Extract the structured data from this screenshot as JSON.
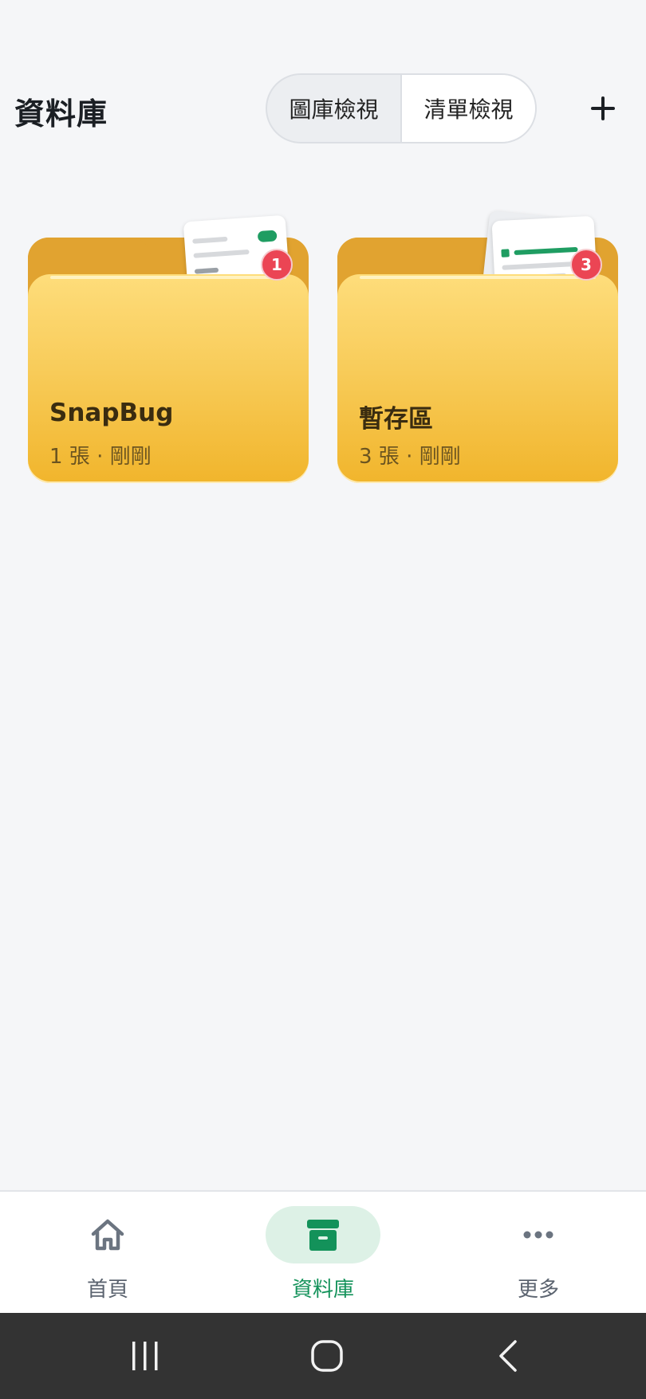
{
  "header": {
    "title": "資料庫",
    "view_toggle": [
      "圖庫檢視",
      "清單檢視"
    ],
    "selected_view": "清單檢視",
    "add_icon": "plus-icon"
  },
  "folders": [
    {
      "name": "SnapBug",
      "meta": "1 張 · 剛剛",
      "badge": "1"
    },
    {
      "name": "暫存區",
      "meta": "3 張 · 剛剛",
      "badge": "3"
    }
  ],
  "bottom_nav": [
    {
      "label": "首頁",
      "icon": "home-icon",
      "active": false
    },
    {
      "label": "資料庫",
      "icon": "archive-icon",
      "active": true
    },
    {
      "label": "更多",
      "icon": "more-icon",
      "active": false
    }
  ],
  "system_nav": [
    "recents-icon",
    "home-button-icon",
    "back-icon"
  ],
  "colors": {
    "accent": "#13925A",
    "accent_soft": "#DDF1E6",
    "badge": "#EB4554",
    "folder_front": "#F8CC5A",
    "folder_back": "#E1A330",
    "background": "#F5F6F8"
  }
}
